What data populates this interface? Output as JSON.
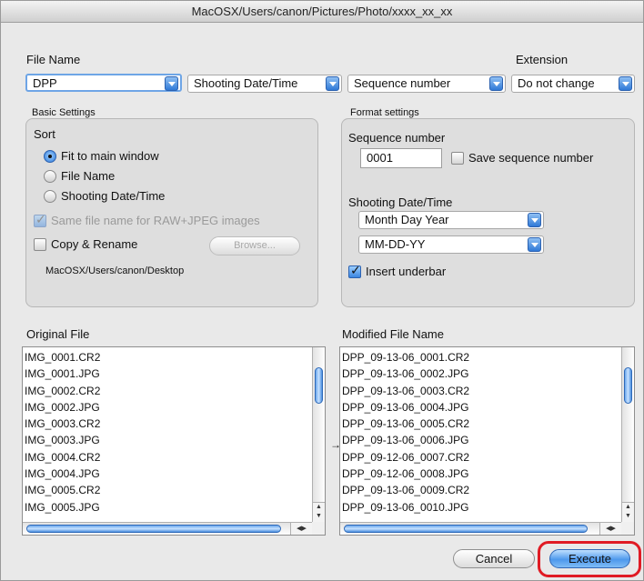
{
  "window": {
    "title": "MacOSX/Users/canon/Pictures/Photo/xxxx_xx_xx"
  },
  "file_name": {
    "label": "File Name",
    "extension_label": "Extension",
    "prefix_value": "DPP",
    "part2_value": "Shooting Date/Time",
    "part3_value": "Sequence number",
    "extension_value": "Do not change"
  },
  "basic_settings": {
    "title": "Basic Settings",
    "sort_label": "Sort",
    "sort_options": [
      "Fit to main window",
      "File Name",
      "Shooting Date/Time"
    ],
    "sort_selected": 0,
    "same_name_label": "Same file name for RAW+JPEG images",
    "same_name_checked": true,
    "copy_rename_label": "Copy & Rename",
    "copy_rename_checked": false,
    "browse_label": "Browse...",
    "dest_path": "MacOSX/Users/canon/Desktop"
  },
  "format_settings": {
    "title": "Format settings",
    "seq_label": "Sequence number",
    "seq_value": "0001",
    "save_seq_label": "Save sequence number",
    "save_seq_checked": false,
    "date_label": "Shooting Date/Time",
    "date_order_value": "Month Day Year",
    "date_format_value": "MM-DD-YY",
    "underbar_label": "Insert underbar",
    "underbar_checked": true
  },
  "original_file": {
    "label": "Original File",
    "items": [
      "IMG_0001.CR2",
      "IMG_0001.JPG",
      "IMG_0002.CR2",
      "IMG_0002.JPG",
      "IMG_0003.CR2",
      "IMG_0003.JPG",
      "IMG_0004.CR2",
      "IMG_0004.JPG",
      "IMG_0005.CR2",
      "IMG_0005.JPG"
    ]
  },
  "modified_file": {
    "label": "Modified File Name",
    "items": [
      "DPP_09-13-06_0001.CR2",
      "DPP_09-13-06_0002.JPG",
      "DPP_09-13-06_0003.CR2",
      "DPP_09-13-06_0004.JPG",
      "DPP_09-13-06_0005.CR2",
      "DPP_09-13-06_0006.JPG",
      "DPP_09-12-06_0007.CR2",
      "DPP_09-12-06_0008.JPG",
      "DPP_09-13-06_0009.CR2",
      "DPP_09-13-06_0010.JPG"
    ]
  },
  "row_arrow": "→",
  "buttons": {
    "cancel": "Cancel",
    "execute": "Execute"
  },
  "icons": {
    "popup_arrow": "chevron-down-icon",
    "scroll_arrows": "scroll-arrows-icon"
  },
  "colors": {
    "highlight": "#e01b24",
    "accent": "#2f79d7"
  }
}
